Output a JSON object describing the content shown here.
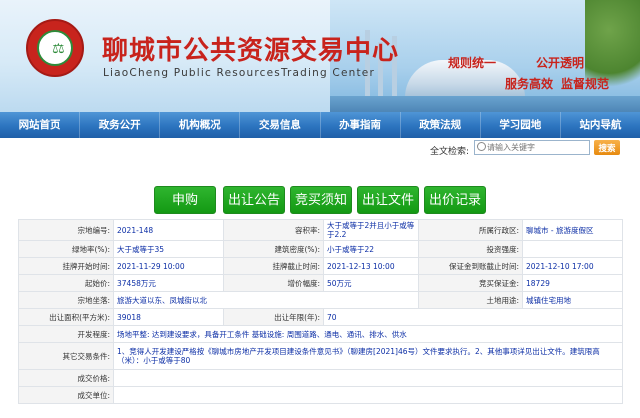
{
  "header": {
    "title": "聊城市公共资源交易中心",
    "subtitle": "LiaoCheng Public ResourcesTrading Center",
    "slogans": [
      "规则统一",
      "公开透明",
      "服务高效",
      "监督规范"
    ],
    "logo_text": "聊城市公共资源交易中心"
  },
  "nav": {
    "items": [
      "网站首页",
      "政务公开",
      "机构概况",
      "交易信息",
      "办事指南",
      "政策法规",
      "学习园地",
      "站内导航"
    ]
  },
  "search": {
    "label": "全文检索:",
    "placeholder": "请输入关键字",
    "button": "搜索"
  },
  "actions": {
    "apply": "申购",
    "notice": "出让公告",
    "guide": "竞买须知",
    "documents": "出让文件",
    "bids": "出价记录"
  },
  "colors": {
    "title_red": "#c8231c",
    "nav_blue": "#2c74bf",
    "button_green": "#139913",
    "value_blue": "#0d2fa6",
    "search_orange": "#e78a0f"
  },
  "detail": {
    "r1": {
      "l1": "宗地编号:",
      "v1": "2021-148",
      "l2": "容积率:",
      "v2": "大于或等于2并且小于或等于2.2",
      "l3": "所属行政区:",
      "v3": "聊城市 - 旅游度假区"
    },
    "r2": {
      "l1": "绿地率(%):",
      "v1": "大于或等于35",
      "l2": "建筑密度(%):",
      "v2": "小于或等于22",
      "l3": "投资强度:",
      "v3": ""
    },
    "r3": {
      "l1": "挂牌开始时间:",
      "v1": "2021-11-29 10:00",
      "l2": "挂牌截止时间:",
      "v2": "2021-12-13 10:00",
      "l3": "保证金到账截止时间:",
      "v3": "2021-12-10 17:00"
    },
    "r4": {
      "l1": "起始价:",
      "v1": "37458万元",
      "l2": "增价幅度:",
      "v2": "50万元",
      "l3": "竞买保证金:",
      "v3": "18729"
    },
    "r5": {
      "l1": "宗地坐落:",
      "v1": "旅游大道以东、凤城街以北",
      "l2": "土地用途:",
      "v2": "城镇住宅用地"
    },
    "r6": {
      "l1": "出让面积(平方米):",
      "v1": "39018",
      "l2": "出让年限(年):",
      "v2": "70"
    },
    "r7": {
      "l1": "开发程度:",
      "v1": "场地平整: 达到建设要求，具备开工条件 基础设施: 周围道路、通电、通讯、排水、供水"
    },
    "r8": {
      "l1": "其它交易条件:",
      "v1": "1、竞得人开发建设严格按《聊城市房地产开发项目建设条件意见书》（聊建房[2021]46号）文件要求执行。2、其他事项详见出让文件。建筑限高（米）：小于或等于80"
    },
    "r9": {
      "l1": "成交价格:",
      "v1": ""
    },
    "r10": {
      "l1": "成交单位:",
      "v1": ""
    }
  }
}
